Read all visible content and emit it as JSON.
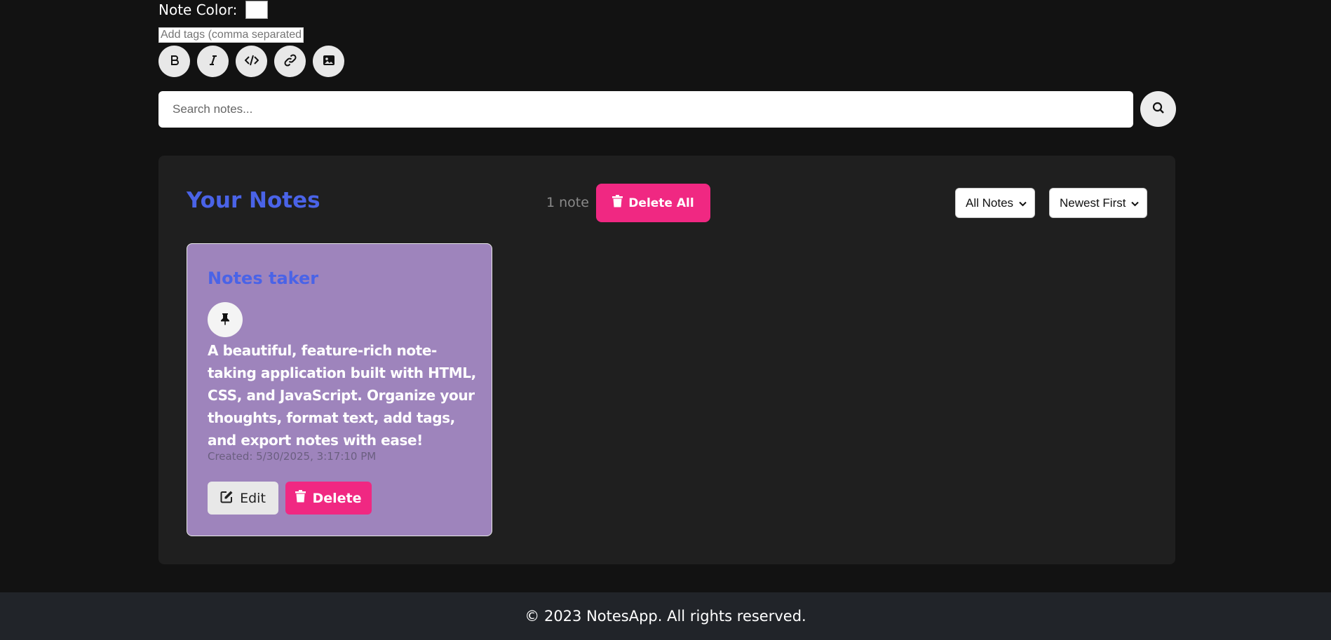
{
  "editor": {
    "color_label": "Note Color:",
    "color_value": "#ffffff",
    "tags_placeholder": "Add tags (comma separated)",
    "toolbar": [
      {
        "name": "bold-icon"
      },
      {
        "name": "italic-icon"
      },
      {
        "name": "code-icon"
      },
      {
        "name": "link-icon"
      },
      {
        "name": "image-icon"
      }
    ]
  },
  "search": {
    "placeholder": "Search notes...",
    "button_icon": "search-icon"
  },
  "notes_panel": {
    "title": "Your Notes",
    "count": "1 note",
    "delete_all_label": "Delete All",
    "filter_selected": "All Notes",
    "sort_selected": "Newest First"
  },
  "notes": [
    {
      "title": "Notes taker",
      "body": "A beautiful, feature-rich note-taking application built with HTML, CSS, and JavaScript. Organize your thoughts, format text, add tags, and export notes with ease!",
      "created": "Created: 5/30/2025, 3:17:10 PM",
      "edit_label": "Edit",
      "delete_label": "Delete",
      "color": "#9e84bc"
    }
  ],
  "footer": {
    "text": "© 2023 NotesApp. All rights reserved."
  },
  "colors": {
    "accent_blue": "#4a63e7",
    "accent_pink": "#f02882",
    "background": "#121212",
    "panel": "#1f1f1f"
  }
}
